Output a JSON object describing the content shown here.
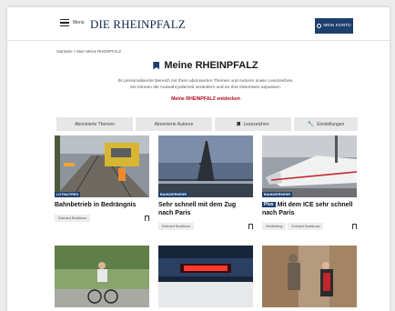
{
  "header": {
    "menu_label": "Menü",
    "logo_text": "DIE RHEINPFALZ",
    "account_label": "MEIN KONTO"
  },
  "breadcrumb": "Startseite  >  Mein  Meine RHEINPFALZ",
  "hero": {
    "title": "Meine RHEINPFALZ",
    "desc_line1": "Ihr personalisierter Bereich mit Ihren abonnierten Themen und Autoren sowie Lesezeichen.",
    "desc_line2": "Sie können die Auswahl jederzeit verändern und an Ihre Interessen anpassen.",
    "link": "Meine RHEINPFALZ entdecken"
  },
  "tabs": [
    {
      "label": "Abonnierte Themen"
    },
    {
      "label": "Abonnierte Autoren"
    },
    {
      "label": "Lesezeichen"
    },
    {
      "label": "Einstellungen"
    }
  ],
  "articles": [
    {
      "tag": "LOTHAITREO",
      "title": "Bahnbetrieb in Bedrängnis",
      "plus": "",
      "tags": [
        "Eckhard Buddruss"
      ]
    },
    {
      "tag": "BAHNVERKEHR",
      "title": "Sehr schnell mit dem Zug nach Paris",
      "plus": "",
      "tags": [
        "Eckhard Buddruss"
      ]
    },
    {
      "tag": "BAHNVERKEHR",
      "title": "Mit dem ICE sehr schnell nach Paris",
      "plus": "Plus",
      "tags": [
        "Heidelberg",
        "Eckhard Buddruss"
      ]
    },
    {
      "tag": "",
      "title": "",
      "plus": "",
      "tags": []
    },
    {
      "tag": "",
      "title": "",
      "plus": "",
      "tags": []
    },
    {
      "tag": "",
      "title": "",
      "plus": "",
      "tags": []
    }
  ],
  "colors": {
    "brand_blue": "#1c3f6e",
    "accent_red": "#b00a1e"
  }
}
